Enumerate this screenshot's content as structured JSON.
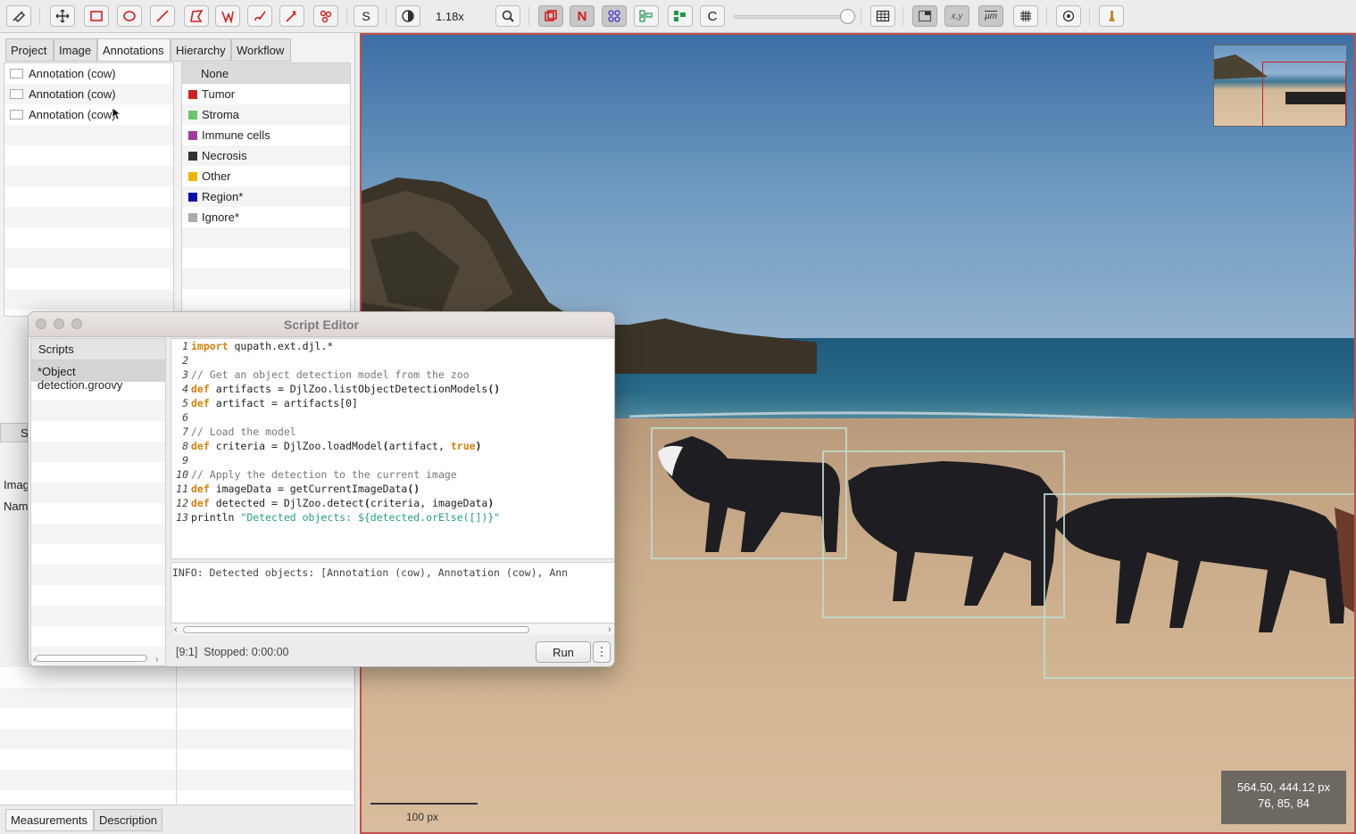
{
  "toolbar": {
    "zoom": "1.18x",
    "s_label": "S",
    "n_label": "N",
    "c_label": "C",
    "xy_label": "x,y",
    "um_label": "µm",
    "icons": [
      "hand-tool-icon",
      "move-icon",
      "rectangle-icon",
      "ellipse-icon",
      "line-icon",
      "polygon-icon",
      "polyline-icon",
      "brush-icon",
      "wand-icon",
      "points-icon",
      "selection-mode-icon",
      "contrast-icon",
      "zoom-to-fit-icon",
      "show-annotations-icon",
      "show-names-icon",
      "show-tma-icon",
      "show-detections-icon",
      "fill-detections-icon",
      "show-pixel-classification-icon",
      "opacity-slider",
      "measurement-table-icon",
      "overview-icon",
      "location-icon",
      "scalebar-icon",
      "grid-icon",
      "preferences-icon",
      "log-icon"
    ]
  },
  "left": {
    "tabs": [
      "Project",
      "Image",
      "Annotations",
      "Hierarchy",
      "Workflow"
    ],
    "annotations": [
      "Annotation (cow)",
      "Annotation (cow)",
      "Annotation (cow)"
    ],
    "classes": [
      {
        "name": "None",
        "color": ""
      },
      {
        "name": "Tumor",
        "color": "#d22020"
      },
      {
        "name": "Stroma",
        "color": "#6cc46c"
      },
      {
        "name": "Immune cells",
        "color": "#a03aa0"
      },
      {
        "name": "Necrosis",
        "color": "#333333"
      },
      {
        "name": "Other",
        "color": "#f0b400"
      },
      {
        "name": "Region*",
        "color": "#0b0bb0"
      },
      {
        "name": "Ignore*",
        "color": "#aaaaaa"
      }
    ],
    "hidden_tab_fragment": "S",
    "image_label_fragment": "Imag",
    "name_label_fragment": "Nam",
    "bottom_tabs": [
      "Measurements",
      "Description"
    ]
  },
  "script_editor": {
    "title": "Script Editor",
    "scripts_header": "Scripts",
    "scripts": [
      "*Object detection.groovy"
    ],
    "code": [
      {
        "n": "1",
        "parts": [
          [
            "kw",
            "import"
          ],
          [
            "",
            "qupath.ext.djl.*"
          ]
        ]
      },
      {
        "n": "2",
        "parts": []
      },
      {
        "n": "3",
        "parts": [
          [
            "cm",
            "// Get an object detection model from the zoo"
          ]
        ]
      },
      {
        "n": "4",
        "parts": [
          [
            "kw",
            "def"
          ],
          [
            "",
            " artifacts = DjlZoo.listObjectDetectionModels"
          ],
          [
            "b",
            "()"
          ]
        ]
      },
      {
        "n": "5",
        "parts": [
          [
            "kw",
            "def"
          ],
          [
            "",
            " artifact = artifacts[0]"
          ]
        ]
      },
      {
        "n": "6",
        "parts": []
      },
      {
        "n": "7",
        "parts": [
          [
            "cm",
            "// Load the model"
          ]
        ]
      },
      {
        "n": "8",
        "parts": [
          [
            "kw",
            "def"
          ],
          [
            "",
            " criteria = DjlZoo.loadModel"
          ],
          [
            "b",
            "("
          ],
          [
            "",
            "artifact, "
          ],
          [
            "kw",
            "true"
          ],
          [
            "b",
            ")"
          ]
        ]
      },
      {
        "n": "9",
        "parts": []
      },
      {
        "n": "10",
        "parts": [
          [
            "cm",
            "// Apply the detection to the current image"
          ]
        ]
      },
      {
        "n": "11",
        "parts": [
          [
            "kw",
            "def"
          ],
          [
            "",
            " imageData = getCurrentImageData"
          ],
          [
            "b",
            "()"
          ]
        ]
      },
      {
        "n": "12",
        "parts": [
          [
            "kw",
            "def"
          ],
          [
            "",
            " detected = DjlZoo.detect"
          ],
          [
            "b",
            "("
          ],
          [
            "",
            "criteria, imageData"
          ],
          [
            "b",
            ")"
          ]
        ]
      },
      {
        "n": "13",
        "parts": [
          [
            "",
            "println "
          ],
          [
            "st",
            "\"Detected objects: ${detected.orElse([])}\""
          ]
        ]
      }
    ],
    "output": "INFO: Detected objects: [Annotation (cow), Annotation (cow), Ann",
    "status": "[9:1]  Stopped: 0:00:00",
    "run_label": "Run",
    "more_label": "⋮"
  },
  "viewer": {
    "coords_line1": "564.50, 444.12 px",
    "coords_line2": "76, 85, 84",
    "scalebar_label": "100 px",
    "detected_objects": 3
  }
}
